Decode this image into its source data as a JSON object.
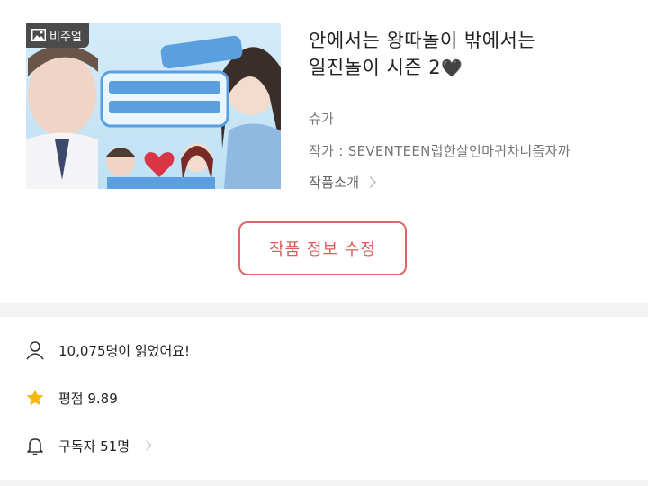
{
  "work": {
    "badge_label": "비주얼",
    "title_line1": "안에서는 왕따놀이 밖에서는",
    "title_line2": "일진놀이 시즌 2",
    "title_heart": "🖤",
    "author": "슈가",
    "artist": "작가 : SEVENTEEN럽한살인마귀차니즘자까",
    "intro_label": "작품소개"
  },
  "actions": {
    "edit_label": "작품 정보 수정"
  },
  "stats": {
    "reads": "10,075명이 읽었어요!",
    "rating": "평점 9.89",
    "subscribers": "구독자 51명"
  },
  "icons": {
    "image": "image-icon",
    "person": "person-icon",
    "star": "star-icon",
    "bell": "bell-icon",
    "chevron": "chevron-right-icon"
  },
  "colors": {
    "accent": "#e05b5b",
    "star": "#f5b80a",
    "badge": "#4b4b4b"
  }
}
